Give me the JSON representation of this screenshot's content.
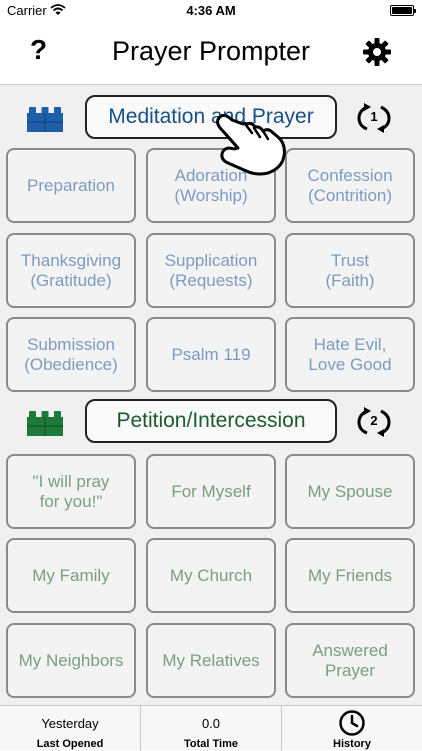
{
  "status_bar": {
    "carrier": "Carrier",
    "time": "4:36 AM"
  },
  "nav": {
    "help_label": "?",
    "title": "Prayer Prompter"
  },
  "sections": [
    {
      "title": "Meditation and Prayer",
      "cycle_number": "1",
      "icon_color": "#1f5fa8",
      "title_color": "#1a4f86",
      "tiles": [
        "Preparation",
        "Adoration\n(Worship)",
        "Confession\n(Contrition)",
        "Thanksgiving\n(Gratitude)",
        "Supplication\n(Requests)",
        "Trust\n(Faith)",
        "Submission\n(Obedience)",
        "Psalm 119",
        "Hate Evil,\nLove Good"
      ]
    },
    {
      "title": "Petition/Intercession",
      "cycle_number": "2",
      "icon_color": "#1e7a3a",
      "title_color": "#1a5a2e",
      "tiles": [
        "\"I will pray\nfor you!\"",
        "For Myself",
        "My Spouse",
        "My Family",
        "My Church",
        "My Friends",
        "My Neighbors",
        "My Relatives",
        "Answered\nPrayer"
      ]
    }
  ],
  "tab_bar": {
    "last_opened_value": "Yesterday",
    "last_opened_label": "Last Opened",
    "total_time_value": "0.0",
    "total_time_label": "Total Time",
    "history_label": "History"
  },
  "icons": {
    "wifi": "wifi-icon",
    "battery": "battery-icon",
    "settings": "gear-icon",
    "section": "building-blocks-icon",
    "cycle": "cycle-icon",
    "pointer": "hand-pointer-icon",
    "history": "clock-icon"
  }
}
